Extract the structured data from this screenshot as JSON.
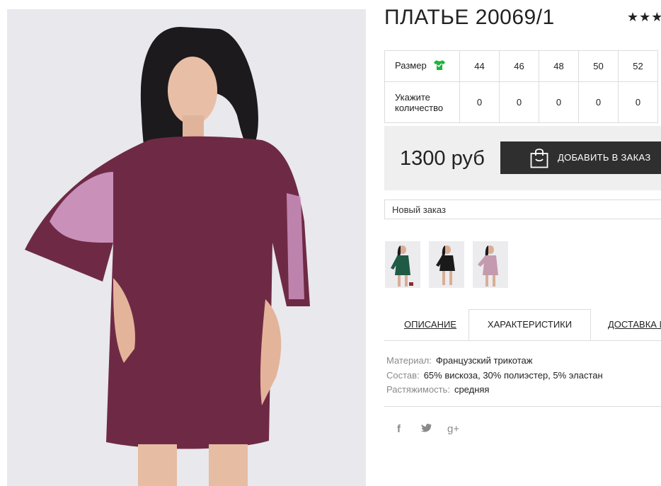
{
  "product": {
    "title": "ПЛАТЬЕ 20069/1",
    "rating_stars": "★★★",
    "price": "1300 руб"
  },
  "size_table": {
    "size_label": "Размер",
    "sizes": [
      "44",
      "46",
      "48",
      "50",
      "52"
    ],
    "qty_label_line1": "Укажите",
    "qty_label_line2": "количество",
    "quantities": [
      "0",
      "0",
      "0",
      "0",
      "0"
    ]
  },
  "buttons": {
    "add_to_order": "ДОБАВИТЬ В ЗАКАЗ"
  },
  "order_select": {
    "selected": "Новый заказ"
  },
  "thumbnails": [
    {
      "color_name": "green",
      "color": "#1f5a45"
    },
    {
      "color_name": "black",
      "color": "#1a1a1a"
    },
    {
      "color_name": "plum",
      "color": "#7a3a55"
    }
  ],
  "tabs": [
    {
      "label": "ОПИСАНИЕ",
      "active": false
    },
    {
      "label": "ХАРАКТЕРИСТИКИ",
      "active": true
    },
    {
      "label": "ДОСТАВКА И",
      "active": false
    }
  ],
  "characteristics": [
    {
      "key": "Материал:",
      "value": "Французский трикотаж"
    },
    {
      "key": "Состав:",
      "value": "65% вискоза, 30% полиэстер, 5% эластан"
    },
    {
      "key": "Растяжимость:",
      "value": "средняя"
    }
  ],
  "social": {
    "facebook": "f",
    "google_plus": "g+"
  },
  "colors": {
    "dress": "#6e2a45",
    "accent_green": "#20b33c",
    "button_dark": "#2f2f2f"
  }
}
